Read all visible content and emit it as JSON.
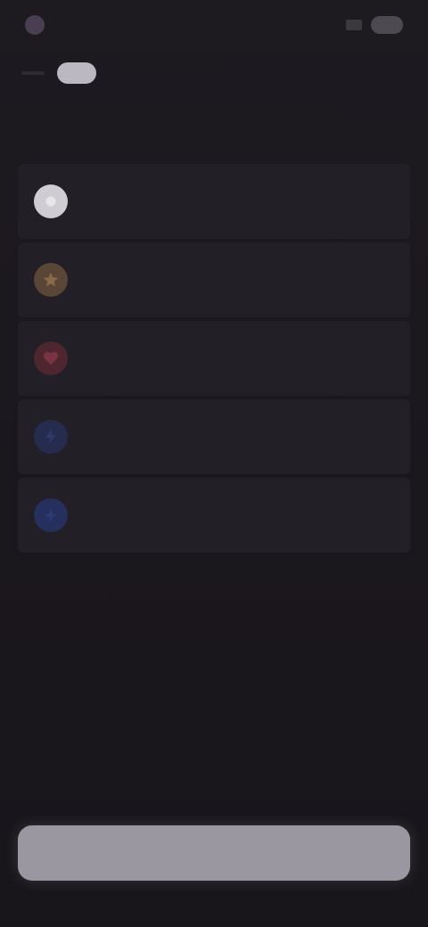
{
  "status_bar": {
    "time": "",
    "icons": [
      "notification-icon",
      "signal-icon",
      "battery-icon"
    ]
  },
  "header": {
    "back_icon": "back-arrow-icon",
    "chip_label": "",
    "hint": ""
  },
  "page": {
    "title": ""
  },
  "options": [
    {
      "label": "",
      "icon": "circle-icon",
      "color": "#cfcdd2"
    },
    {
      "label": "",
      "icon": "star-icon",
      "color": "#8a6a4a"
    },
    {
      "label": "",
      "icon": "heart-icon",
      "color": "#7a3440"
    },
    {
      "label": "",
      "icon": "bolt-icon",
      "color": "#2f3a6a"
    },
    {
      "label": "",
      "icon": "sparkle-icon",
      "color": "#2e3d78"
    }
  ],
  "bottom_button": {
    "label": ""
  },
  "colors": {
    "background": "#19161c",
    "card": "#221f26",
    "button": "#9b97a0"
  }
}
